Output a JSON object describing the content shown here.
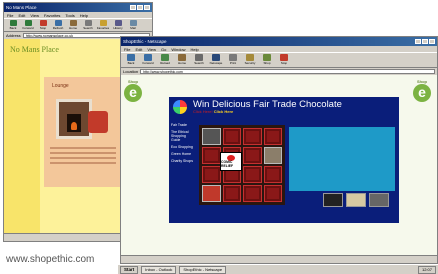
{
  "caption": "www.shopethic.com",
  "back_window": {
    "title": "No Mans Place",
    "menu": [
      "File",
      "Edit",
      "View",
      "Favorites",
      "Tools",
      "Help"
    ],
    "toolbar": [
      "Back",
      "Forward",
      "Stop",
      "Refresh",
      "Home",
      "Search",
      "Favorites",
      "History",
      "Mail"
    ],
    "address_label": "Address",
    "address": "http://www.nomansplace.co.uk",
    "page": {
      "logo": "No Mans Place",
      "heading": "Lounge"
    }
  },
  "front_window": {
    "title": "ShopEthic - Netscape",
    "menu": [
      "File",
      "Edit",
      "View",
      "Go",
      "Window",
      "Help"
    ],
    "toolbar": [
      "Back",
      "Forward",
      "Reload",
      "Home",
      "Search",
      "Netscape",
      "Print",
      "Security",
      "Shop",
      "Stop"
    ],
    "address_label": "Location",
    "address": "http://www.shopethic.com",
    "brand": {
      "name": "Shop",
      "letter": "e"
    },
    "promo": {
      "title": "Win Delicious Fair Trade Chocolate",
      "subtitle_lead": "Click Here!",
      "subtitle_link": "Click Here",
      "side_menu": [
        "Fair Trade",
        "The Ethical Shopping Guide",
        "Eco Shopping",
        "Green Home",
        "Charity Shops"
      ],
      "comic_relief": "COMIC RELIEF"
    },
    "bottom_links": "[ Home | Fair Trade | Shopping Guide | Contact Us | Links ]"
  },
  "taskbar": {
    "start": "Start",
    "items": [
      "Inbox - Outlook",
      "ShopEthic - Netscape"
    ],
    "tray": "12:07"
  },
  "colors": {
    "promo_bg": "#0a1e7a",
    "accent_green": "#7cb342",
    "back_page_bg": "#fdf29a",
    "right_col": "#1e9ac8"
  }
}
